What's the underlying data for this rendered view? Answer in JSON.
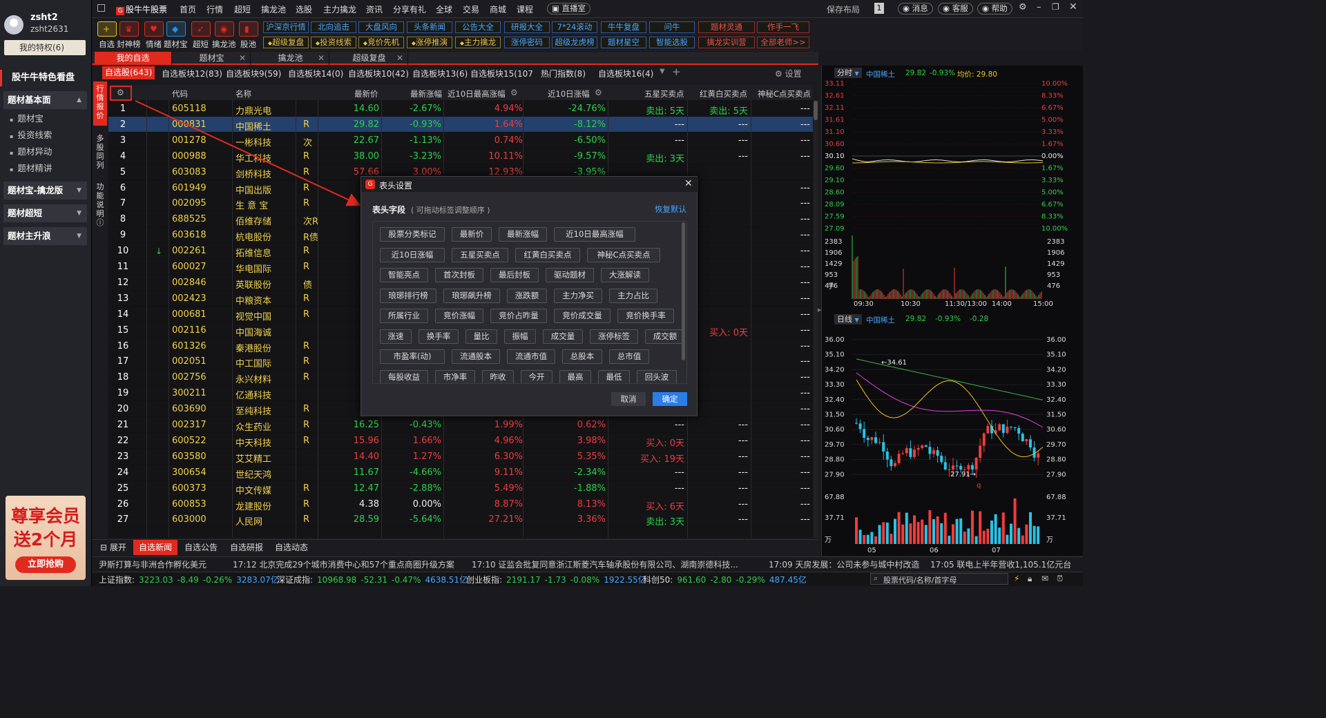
{
  "user": {
    "name": "zsht2",
    "id": "zsht2631",
    "privilege": "我的特权(6)"
  },
  "left": {
    "featured": "股牛牛特色看盘",
    "groups": [
      {
        "title": "题材基本面",
        "items": [
          "题材宝",
          "投资线索",
          "题材异动",
          "题材精讲"
        ]
      },
      {
        "title": "题材宝-擒龙版"
      },
      {
        "title": "题材超短"
      },
      {
        "title": "题材主升浪"
      }
    ],
    "promo": {
      "line1": "尊享会员",
      "line2": "送2个月",
      "button": "立即抢购"
    }
  },
  "topbar": {
    "logo": "股牛牛股票",
    "nav": [
      "首页",
      "行情",
      "超短",
      "擒龙池",
      "选股",
      "主力擒龙",
      "资讯",
      "分享有礼",
      "全球",
      "交易",
      "商城",
      "课程"
    ],
    "live": "直播室",
    "save_layout": "保存布局",
    "layout_num": "1",
    "buttons": [
      "消息",
      "客服",
      "帮助"
    ]
  },
  "toolbar": {
    "icons": [
      {
        "label": "自选",
        "icon": "plus-icon",
        "color": "#f0c419"
      },
      {
        "label": "封神榜",
        "icon": "trophy-icon",
        "color": "#e12a1e"
      },
      {
        "label": "情绪",
        "icon": "heart-icon",
        "color": "#e12a1e"
      },
      {
        "label": "题材宝",
        "icon": "gem-icon",
        "color": "#2b8de0"
      },
      {
        "label": "超短",
        "icon": "rocket-icon",
        "color": "#e12a1e"
      },
      {
        "label": "擒龙池",
        "icon": "dragon-icon",
        "color": "#e12a1e"
      },
      {
        "label": "股池",
        "icon": "chart-bars-icon",
        "color": "#e12a1e"
      }
    ],
    "row1": [
      "沪深京行情",
      "北向追击",
      "大盘风向",
      "头条新闻",
      "公告大全",
      "研报大全",
      "7*24滚动",
      "牛牛复盘",
      "问牛",
      "题材灵通",
      "作手一飞"
    ],
    "row2": [
      "超级复盘",
      "投资线索",
      "竞价先机",
      "涨停推演",
      "主力擒龙",
      "涨停密码",
      "超级龙虎榜",
      "题材星空",
      "智能选股",
      "擒龙实训营",
      "全部老师>>"
    ]
  },
  "main_tabs": [
    "我的自选",
    "题材宝",
    "擒龙池",
    "超级复盘"
  ],
  "sub_tabs": [
    "自选股(643)",
    "自选板块12(83)",
    "自选板块9(59)",
    "自选板块14(0)",
    "自选板块10(42)",
    "自选板块13(6)",
    "自选板块15(107",
    "热门指数(8)",
    "自选板块16(4)"
  ],
  "settings_label": "设置",
  "vtabs": [
    "行情报价",
    "多股同列",
    "功能说明"
  ],
  "columns": [
    "代码",
    "名称",
    "最新价",
    "最新涨幅",
    "近10日最高涨幅",
    "近10日涨幅",
    "五星买卖点",
    "红黄白买卖点",
    "神秘C点买卖点"
  ],
  "rows": [
    {
      "i": "1",
      "code": "605118",
      "name": "力鼎光电",
      "tag": "",
      "price": "14.60",
      "chg": "-2.67%",
      "hi": "4.94%",
      "r10": "-24.76%",
      "b5": "卖出: 5天",
      "bh": "卖出: 5天",
      "bs": "---"
    },
    {
      "i": "2",
      "code": "000831",
      "name": "中国稀土",
      "tag": "R",
      "price": "29.82",
      "chg": "-0.93%",
      "hi": "1.64%",
      "r10": "-8.12%",
      "b5": "---",
      "bh": "---",
      "bs": "---"
    },
    {
      "i": "3",
      "code": "001278",
      "name": "一彬科技",
      "tag": "次",
      "price": "22.67",
      "chg": "-1.13%",
      "hi": "0.74%",
      "r10": "-6.50%",
      "b5": "---",
      "bh": "---",
      "bs": "---"
    },
    {
      "i": "4",
      "code": "000988",
      "name": "华工科技",
      "tag": "R",
      "price": "38.00",
      "chg": "-3.23%",
      "hi": "10.11%",
      "r10": "-9.57%",
      "b5": "卖出: 3天",
      "bh": "---",
      "bs": "---"
    },
    {
      "i": "5",
      "code": "603083",
      "name": "剑桥科技",
      "tag": "R",
      "price": "57.66",
      "chg": "3.00%",
      "hi": "12.93%",
      "r10": "-3.95%",
      "b5": "",
      "bh": "",
      "bs": ""
    },
    {
      "i": "6",
      "code": "601949",
      "name": "中国出版",
      "tag": "R",
      "price": "",
      "chg": "",
      "hi": "",
      "r10": "",
      "b5": "",
      "bh": "",
      "bs": "---"
    },
    {
      "i": "7",
      "code": "002095",
      "name": "生 意 宝",
      "tag": "R",
      "price": "",
      "chg": "",
      "hi": "",
      "r10": "",
      "b5": "",
      "bh": "",
      "bs": "---"
    },
    {
      "i": "8",
      "code": "688525",
      "name": "佰维存储",
      "tag": "次R",
      "price": "8",
      "chg": "",
      "hi": "",
      "r10": "",
      "b5": "",
      "bh": "",
      "bs": "---"
    },
    {
      "i": "9",
      "code": "603618",
      "name": "杭电股份",
      "tag": "R债",
      "price": "",
      "chg": "",
      "hi": "",
      "r10": "",
      "b5": "",
      "bh": "",
      "bs": "---"
    },
    {
      "i": "10",
      "code": "002261",
      "name": "拓维信息",
      "tag": "R",
      "price": "1",
      "chg": "",
      "hi": "",
      "r10": "",
      "b5": "",
      "bh": "",
      "bs": "---"
    },
    {
      "i": "11",
      "code": "600027",
      "name": "华电国际",
      "tag": "R",
      "price": "",
      "chg": "",
      "hi": "",
      "r10": "",
      "b5": "",
      "bh": "",
      "bs": "---"
    },
    {
      "i": "12",
      "code": "002846",
      "name": "英联股份",
      "tag": "债",
      "price": "1",
      "chg": "",
      "hi": "",
      "r10": "",
      "b5": "",
      "bh": "",
      "bs": "---"
    },
    {
      "i": "13",
      "code": "002423",
      "name": "中粮资本",
      "tag": "R",
      "price": "",
      "chg": "",
      "hi": "",
      "r10": "",
      "b5": "",
      "bh": "",
      "bs": "---"
    },
    {
      "i": "14",
      "code": "000681",
      "name": "视觉中国",
      "tag": "R",
      "price": "1",
      "chg": "",
      "hi": "",
      "r10": "",
      "b5": "",
      "bh": "",
      "bs": "---"
    },
    {
      "i": "15",
      "code": "002116",
      "name": "中国海诚",
      "tag": "",
      "price": "",
      "chg": "",
      "hi": "",
      "r10": "",
      "b5": "",
      "bh": "买入: 0天",
      "bs": "---"
    },
    {
      "i": "16",
      "code": "601326",
      "name": "秦港股份",
      "tag": "R",
      "price": "",
      "chg": "",
      "hi": "",
      "r10": "",
      "b5": "",
      "bh": "",
      "bs": "---"
    },
    {
      "i": "17",
      "code": "002051",
      "name": "中工国际",
      "tag": "R",
      "price": "",
      "chg": "",
      "hi": "",
      "r10": "",
      "b5": "",
      "bh": "",
      "bs": "---"
    },
    {
      "i": "18",
      "code": "002756",
      "name": "永兴材料",
      "tag": "R",
      "price": "5",
      "chg": "",
      "hi": "",
      "r10": "",
      "b5": "",
      "bh": "",
      "bs": "---"
    },
    {
      "i": "19",
      "code": "300211",
      "name": "亿通科技",
      "tag": "",
      "price": "",
      "chg": "",
      "hi": "",
      "r10": "",
      "b5": "",
      "bh": "",
      "bs": "---"
    },
    {
      "i": "20",
      "code": "603690",
      "name": "至纯科技",
      "tag": "R",
      "price": "3",
      "chg": "",
      "hi": "",
      "r10": "",
      "b5": "",
      "bh": "",
      "bs": "---"
    },
    {
      "i": "21",
      "code": "002317",
      "name": "众生药业",
      "tag": "R",
      "price": "16.25",
      "chg": "-0.43%",
      "hi": "1.99%",
      "r10": "0.62%",
      "b5": "---",
      "bh": "---",
      "bs": "---"
    },
    {
      "i": "22",
      "code": "600522",
      "name": "中天科技",
      "tag": "R",
      "price": "15.96",
      "chg": "1.66%",
      "hi": "4.96%",
      "r10": "3.98%",
      "b5": "买入: 0天",
      "bh": "---",
      "bs": "---"
    },
    {
      "i": "23",
      "code": "603580",
      "name": "艾艾精工",
      "tag": "",
      "price": "14.40",
      "chg": "1.27%",
      "hi": "6.30%",
      "r10": "5.35%",
      "b5": "买入: 19天",
      "bh": "---",
      "bs": "---"
    },
    {
      "i": "24",
      "code": "300654",
      "name": "世纪天鸿",
      "tag": "",
      "price": "11.67",
      "chg": "-4.66%",
      "hi": "9.11%",
      "r10": "-2.34%",
      "b5": "---",
      "bh": "---",
      "bs": "---"
    },
    {
      "i": "25",
      "code": "600373",
      "name": "中文传媒",
      "tag": "R",
      "price": "12.47",
      "chg": "-2.88%",
      "hi": "5.49%",
      "r10": "-1.88%",
      "b5": "---",
      "bh": "---",
      "bs": "---"
    },
    {
      "i": "26",
      "code": "600853",
      "name": "龙建股份",
      "tag": "R",
      "price": "4.38",
      "chg": "0.00%",
      "hi": "8.87%",
      "r10": "8.13%",
      "b5": "买入: 6天",
      "bh": "---",
      "bs": "---"
    },
    {
      "i": "27",
      "code": "603000",
      "name": "人民网",
      "tag": "R",
      "price": "28.59",
      "chg": "-5.64%",
      "hi": "27.21%",
      "r10": "3.36%",
      "b5": "卖出: 3天",
      "bh": "---",
      "bs": "---"
    }
  ],
  "dialog": {
    "title": "表头设置",
    "section": "表头字段",
    "hint": "( 可拖动标签调整顺序 )",
    "reset": "恢复默认",
    "cancel": "取消",
    "ok": "确定",
    "chips": [
      [
        "股票分类标记",
        "最新价",
        "最新涨幅",
        "近10日最高涨幅"
      ],
      [
        "近10日涨幅",
        "五星买卖点",
        "红黄白买卖点",
        "神秘C点买卖点"
      ],
      [
        "智能亮点",
        "首次封板",
        "最后封板",
        "驱动题材",
        "大涨解读"
      ],
      [
        "琅琊排行榜",
        "琅琊飙升榜",
        "涨跌额",
        "主力净买",
        "主力占比"
      ],
      [
        "所属行业",
        "竞价涨幅",
        "竞价占昨量",
        "竞价成交量",
        "竞价换手率"
      ],
      [
        "涨速",
        "换手率",
        "量比",
        "振幅",
        "成交量",
        "涨停标签",
        "成交额"
      ],
      [
        "市盈率(动)",
        "流通股本",
        "流通市值",
        "总股本",
        "总市值"
      ],
      [
        "每股收益",
        "市净率",
        "昨收",
        "今开",
        "最高",
        "最低",
        "回头波"
      ]
    ]
  },
  "bottom_tabs": [
    "展开",
    "自选新闻",
    "自选公告",
    "自选研报",
    "自选动态"
  ],
  "news": [
    "尹斯打算与非洲合作孵化美元",
    "17:12 北京完成29个城市消费中心和57个重点商圈升级方案",
    "17:10 证监会批复同意浙江斯菱汽车轴承股份有限公司、湖南崇德科技...",
    "17:09 天房发展：公司未参与城中村改造",
    "17:05 联电上半年营收1,105.1亿元台"
  ],
  "status": [
    {
      "label": "上证指数:",
      "v": "3223.03",
      "d": "-8.49",
      "p": "-0.26%",
      "a": "3283.07亿"
    },
    {
      "label": "深证成指:",
      "v": "10968.98",
      "d": "-52.31",
      "p": "-0.47%",
      "a": "4638.51亿"
    },
    {
      "label": "创业板指:",
      "v": "2191.17",
      "d": "-1.73",
      "p": "-0.08%",
      "a": "1922.55亿"
    },
    {
      "label": "科创50:",
      "v": "961.60",
      "d": "-2.80",
      "p": "-0.29%",
      "a": "487.45亿"
    }
  ],
  "search_placeholder": "股票代码/名称/首字母",
  "intraday": {
    "mode": "分时",
    "name": "中国稀土",
    "price": "29.82",
    "chg": "-0.93%",
    "avg_label": "均价: 29.80",
    "y_left": [
      "33.11",
      "32.61",
      "32.11",
      "31.61",
      "31.10",
      "30.60",
      "30.10",
      "29.60",
      "29.10",
      "28.60",
      "28.09",
      "27.59",
      "27.09"
    ],
    "y_right": [
      "10.00%",
      "8.33%",
      "6.67%",
      "5.00%",
      "3.33%",
      "1.67%",
      "0.00%",
      "1.67%",
      "3.33%",
      "5.00%",
      "6.67%",
      "8.33%",
      "10.00%"
    ],
    "vol": [
      "2383",
      "1906",
      "1429",
      "953",
      "476"
    ],
    "vol_unit": "手",
    "times": [
      "09:30",
      "10:30",
      "11:30/13:00",
      "14:00",
      "15:00"
    ]
  },
  "daily": {
    "mode": "日线",
    "name": "中国稀土",
    "price": "29.82",
    "chg": "-0.93%",
    "d": "-0.28",
    "y": [
      "36.00",
      "35.10",
      "34.20",
      "33.30",
      "32.40",
      "31.50",
      "30.60",
      "29.70",
      "28.80",
      "27.90"
    ],
    "hi_mark": "34.61",
    "lo_mark": "27.91",
    "q_mark": "q",
    "vol": [
      "67.88",
      "37.71"
    ],
    "vol_unit": "万",
    "months": [
      "05",
      "06",
      "07"
    ]
  },
  "colors": {
    "up": "#f03c3c",
    "down": "#2fd049",
    "accent": "#e12a1e",
    "code": "#f0d24a"
  }
}
